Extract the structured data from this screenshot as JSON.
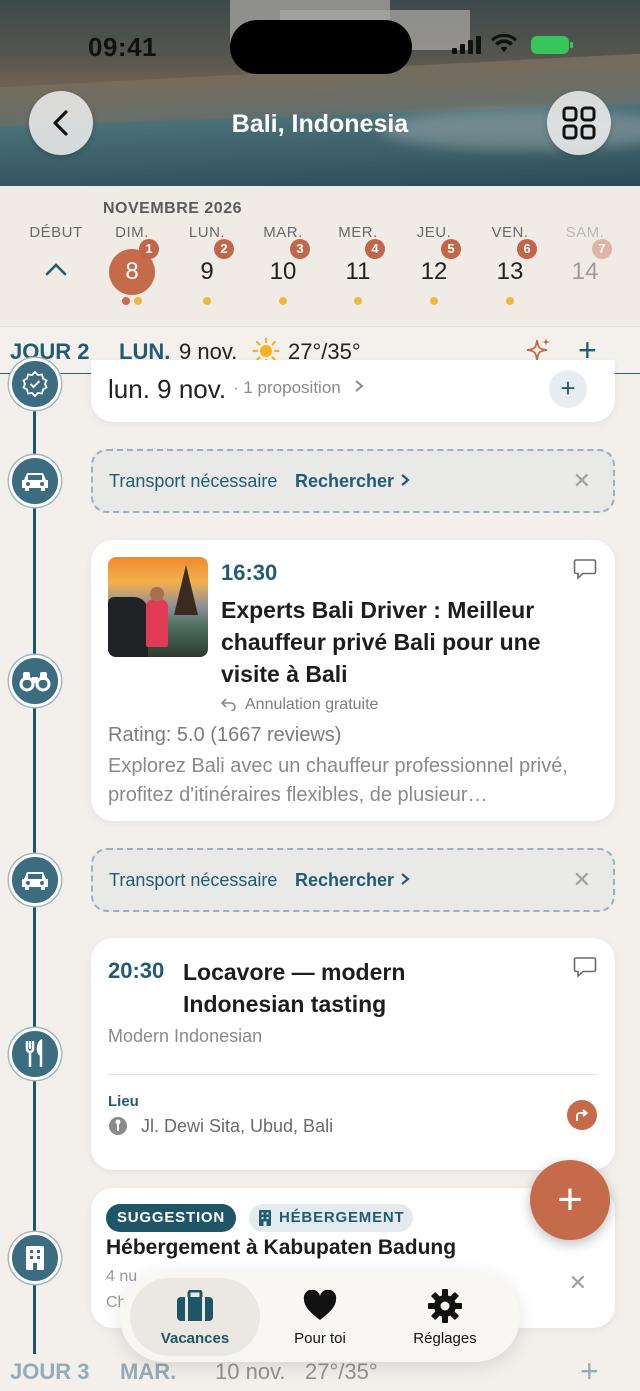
{
  "status": {
    "time": "09:41"
  },
  "header": {
    "title": "Bali, Indonesia",
    "back_icon": "chevron-left-icon",
    "grid_icon": "grid-icon"
  },
  "calendar": {
    "month": "NOVEMBRE 2026",
    "start_label": "DÉBUT",
    "days": [
      {
        "name": "DIM.",
        "num": "8",
        "badge": "1"
      },
      {
        "name": "LUN.",
        "num": "9",
        "badge": "2"
      },
      {
        "name": "MAR.",
        "num": "10",
        "badge": "3"
      },
      {
        "name": "MER.",
        "num": "11",
        "badge": "4"
      },
      {
        "name": "JEU.",
        "num": "12",
        "badge": "5"
      },
      {
        "name": "VEN.",
        "num": "13",
        "badge": "6"
      },
      {
        "name": "SAM.",
        "num": "14",
        "badge": "7"
      }
    ],
    "accent": "#c56b4a",
    "dot_color": "#f0b73a"
  },
  "day_header": {
    "jour": "JOUR 2",
    "weekday": "LUN.",
    "date": "9 nov.",
    "temp": "27°/35°"
  },
  "top_card": {
    "title": "lun. 9 nov.",
    "sub": "· 1 proposition"
  },
  "transport": {
    "label": "Transport nécessaire",
    "action": "Rechercher"
  },
  "activity": {
    "time": "16:30",
    "title": "Experts Bali Driver : Meilleur chauffeur privé Bali pour une visite à Bali",
    "cancellation": "Annulation gratuite",
    "rating": "Rating: 5.0 (1667 reviews)",
    "description": "Explorez Bali avec un chauffeur professionnel privé, profitez d'itinéraires flexibles, de plusieur…"
  },
  "restaurant": {
    "time": "20:30",
    "title": "Locavore — modern Indonesian tasting",
    "cuisine": "Modern Indonesian",
    "place_label": "Lieu",
    "address": "Jl. Dewi Sita, Ubud, Bali"
  },
  "suggestion": {
    "badge": "SUGGESTION",
    "category": "HÉBERGEMENT",
    "title": "Hébergement à Kabupaten Badung",
    "sub": "4 nu",
    "sub2": "Ch"
  },
  "next_day": {
    "jour": "JOUR 3",
    "weekday": "MAR.",
    "date": "10 nov.",
    "temp": "27°/35°"
  },
  "tabs": [
    {
      "label": "Vacances",
      "icon": "suitcase-icon"
    },
    {
      "label": "Pour toi",
      "icon": "heart-icon"
    },
    {
      "label": "Réglages",
      "icon": "gear-icon"
    }
  ],
  "colors": {
    "primary": "#225c74",
    "accent": "#c56b4a"
  }
}
